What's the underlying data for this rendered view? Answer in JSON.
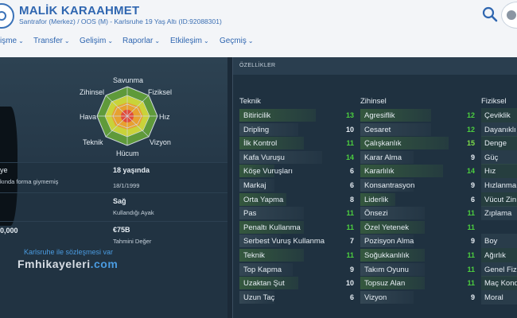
{
  "header": {
    "player_name": "MALİK KARAAHMET",
    "player_sub": "Santrafor (Merkez) / OOS (M) - Karlsruhe 19 Yaş Altı (ID:92088301)"
  },
  "nav": [
    {
      "label": "işme"
    },
    {
      "label": "Transfer"
    },
    {
      "label": "Gelişim"
    },
    {
      "label": "Raporlar"
    },
    {
      "label": "Etkileşim"
    },
    {
      "label": "Geçmiş"
    }
  ],
  "radar": {
    "labels": {
      "top": "Savunma",
      "top_left": "Zihinsel",
      "top_right": "Fiziksel",
      "left": "Hava",
      "right": "Hız",
      "bottom_left": "Teknik",
      "bottom_right": "Vizyon",
      "bottom": "Hücum"
    }
  },
  "info": {
    "row1_left": "ye",
    "row1_right": "18 yaşında",
    "row2_left": "kında forma giymemiş",
    "row2_right": "18/1/1999",
    "row3_right": "Sağ",
    "row3_right_sub": "Kullandığı Ayak",
    "row4_left": "0,000",
    "row4_right": "€75B",
    "row4_right_sub": "Tahmini Değer",
    "contract_link": "Karlsruhe ile sözleşmesi var",
    "watermark_a": "Fmhikayeleri",
    "watermark_b": ".com"
  },
  "attributes": {
    "header": "ÖZELLİKLER",
    "teknik": {
      "title": "Teknik",
      "items": [
        {
          "name": "Bitiricilik",
          "value": "13",
          "level": 0.65,
          "color": "green"
        },
        {
          "name": "Dripling",
          "value": "10",
          "level": 0.5,
          "color": "white"
        },
        {
          "name": "İlk Kontrol",
          "value": "11",
          "level": 0.55,
          "color": "green"
        },
        {
          "name": "Kafa Vuruşu",
          "value": "14",
          "level": 0.7,
          "color": "green"
        },
        {
          "name": "Köşe Vuruşları",
          "value": "6",
          "level": 0.3,
          "color": "white"
        },
        {
          "name": "Markaj",
          "value": "6",
          "level": 0.3,
          "color": "white"
        },
        {
          "name": "Orta Yapma",
          "value": "8",
          "level": 0.4,
          "color": "white"
        },
        {
          "name": "Pas",
          "value": "11",
          "level": 0.55,
          "color": "green"
        },
        {
          "name": "Penaltı Kullanma",
          "value": "11",
          "level": 0.55,
          "color": "green"
        },
        {
          "name": "Serbest Vuruş Kullanma",
          "value": "7",
          "level": 0.35,
          "color": "white"
        },
        {
          "name": "Teknik",
          "value": "11",
          "level": 0.55,
          "color": "green"
        },
        {
          "name": "Top Kapma",
          "value": "9",
          "level": 0.45,
          "color": "white"
        },
        {
          "name": "Uzaktan Şut",
          "value": "10",
          "level": 0.5,
          "color": "white"
        },
        {
          "name": "Uzun Taç",
          "value": "6",
          "level": 0.3,
          "color": "white"
        }
      ]
    },
    "zihinsel": {
      "title": "Zihinsel",
      "items": [
        {
          "name": "Agresiflik",
          "value": "12",
          "level": 0.6,
          "color": "green"
        },
        {
          "name": "Cesaret",
          "value": "12",
          "level": 0.6,
          "color": "green"
        },
        {
          "name": "Çalışkanlık",
          "value": "15",
          "level": 0.75,
          "color": "bright"
        },
        {
          "name": "Karar Alma",
          "value": "9",
          "level": 0.45,
          "color": "white"
        },
        {
          "name": "Kararlılık",
          "value": "14",
          "level": 0.7,
          "color": "green"
        },
        {
          "name": "Konsantrasyon",
          "value": "9",
          "level": 0.45,
          "color": "white"
        },
        {
          "name": "Liderlik",
          "value": "6",
          "level": 0.3,
          "color": "white"
        },
        {
          "name": "Önsezi",
          "value": "11",
          "level": 0.55,
          "color": "green"
        },
        {
          "name": "Özel Yetenek",
          "value": "11",
          "level": 0.55,
          "color": "green"
        },
        {
          "name": "Pozisyon Alma",
          "value": "9",
          "level": 0.45,
          "color": "white"
        },
        {
          "name": "Soğukkanlılık",
          "value": "11",
          "level": 0.55,
          "color": "green"
        },
        {
          "name": "Takım Oyunu",
          "value": "11",
          "level": 0.55,
          "color": "green"
        },
        {
          "name": "Topsuz Alan",
          "value": "11",
          "level": 0.55,
          "color": "green"
        },
        {
          "name": "Vizyon",
          "value": "9",
          "level": 0.45,
          "color": "white"
        }
      ]
    },
    "fiziksel": {
      "title": "Fiziksel",
      "items": [
        {
          "name": "Çeviklik",
          "row": 0
        },
        {
          "name": "Dayanıklı",
          "row": 1
        },
        {
          "name": "Denge",
          "row": 2
        },
        {
          "name": "Güç",
          "row": 3
        },
        {
          "name": "Hız",
          "row": 4
        },
        {
          "name": "Hızlanma",
          "row": 5
        },
        {
          "name": "Vücut Zin",
          "row": 6
        },
        {
          "name": "Zıplama",
          "row": 7
        },
        {
          "name": "Boy",
          "row": 9
        },
        {
          "name": "Ağırlık",
          "row": 10
        },
        {
          "name": "Genel Fiz",
          "row": 11
        },
        {
          "name": "Maç Kond",
          "row": 12
        },
        {
          "name": "Moral",
          "row": 13
        }
      ]
    }
  },
  "colors": {
    "accent": "#2f66b0",
    "green_value": "#4ccf3f",
    "bright_value": "#7fe04a",
    "panel_bg": "#1f3140"
  }
}
